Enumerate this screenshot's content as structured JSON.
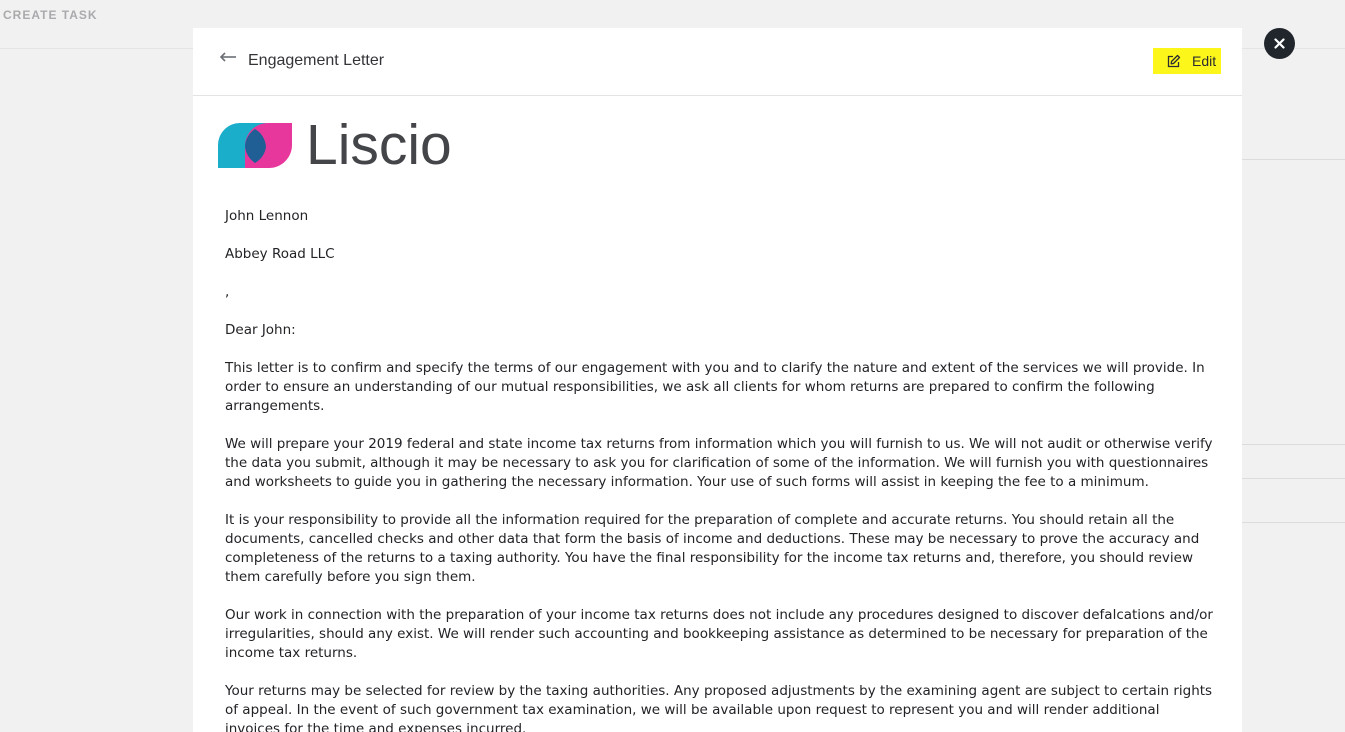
{
  "background": {
    "title": "CREATE TASK"
  },
  "modal": {
    "title": "Engagement Letter",
    "edit_label": "Edit",
    "logo_text": "Liscio",
    "back_icon": "arrow-left-icon",
    "edit_icon": "edit-icon",
    "close_icon": "close-icon"
  },
  "letter": {
    "recipient_name": "John Lennon",
    "company": "Abbey Road LLC",
    "address": ",",
    "salutation": "Dear John:",
    "paragraphs": [
      "This letter is to confirm and specify the terms of our engagement with you and to clarify the nature and extent of the services we will provide. In order to ensure an understanding of our mutual responsibilities, we ask all clients for whom returns are prepared to confirm the following arrangements.",
      "We will prepare your 2019 federal and state income tax returns from information which you will furnish to us. We will not audit or otherwise verify the data you submit, although it may be necessary to ask you for clarification of some of the information. We will furnish you with questionnaires and worksheets to guide you in gathering the necessary information. Your use of such forms will assist in keeping the fee to a minimum.",
      "It is your responsibility to provide all the information required for the preparation of complete and accurate returns. You should retain all the documents, cancelled checks and other data that form the basis of income and deductions. These may be necessary to prove the accuracy and completeness of the returns to a taxing authority. You have the final responsibility for the income tax returns and, therefore, you should review them carefully before you sign them.",
      "Our work in connection with the preparation of your income tax returns does not include any procedures designed to discover defalcations and/or irregularities, should any exist. We will render such accounting and bookkeeping assistance as determined to be necessary for preparation of the income tax returns.",
      "Your returns may be selected for review by the taxing authorities. Any proposed adjustments by the examining agent are subject to certain rights of appeal. In the event of such government tax examination, we will be available upon request to represent you and will render additional invoices for the time and expenses incurred."
    ]
  },
  "colors": {
    "highlight": "#fcf61b",
    "logo_cyan": "#1aaecb",
    "logo_magenta": "#e8379c",
    "logo_overlap": "#1f5f96",
    "close_bg": "#21262d"
  }
}
